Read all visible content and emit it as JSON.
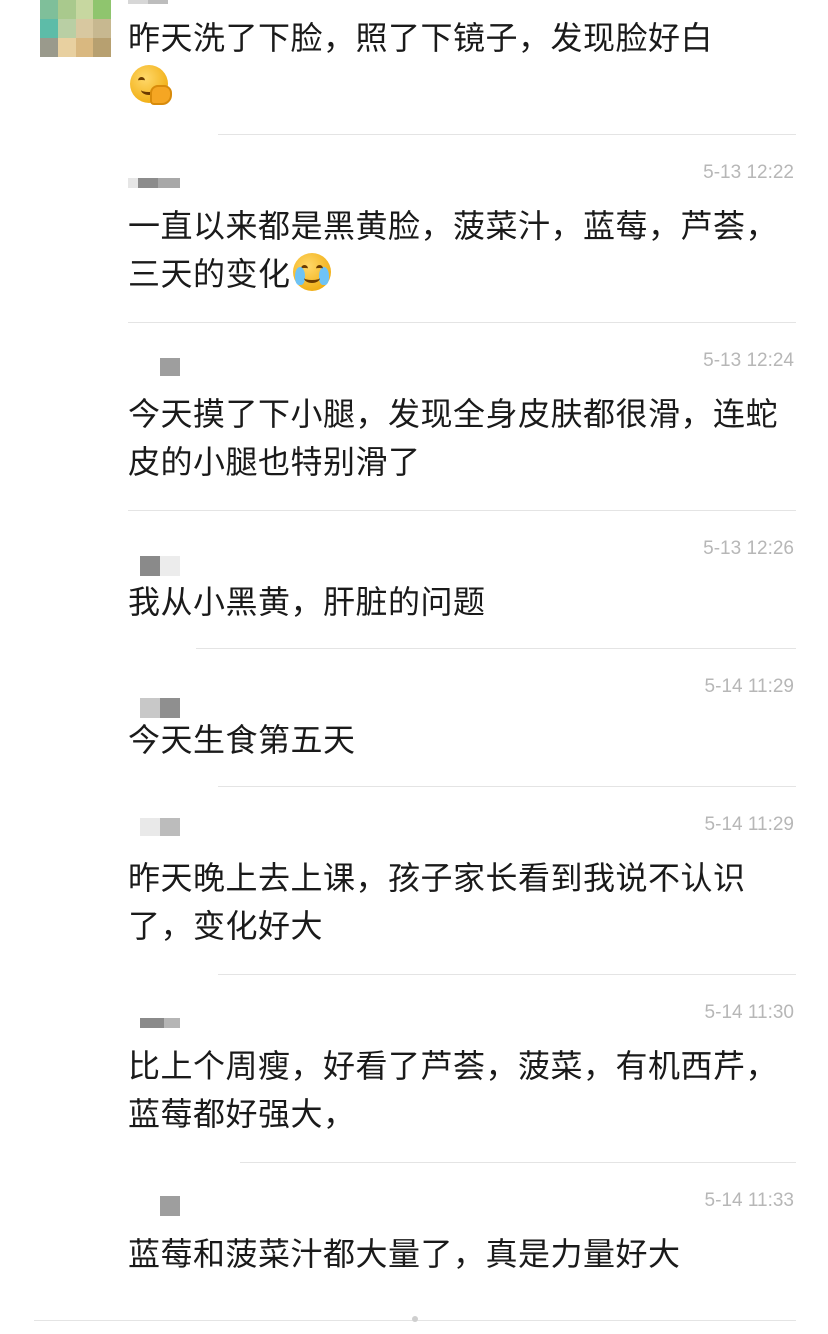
{
  "comments": [
    {
      "text": "昨天洗了下脸，照了下镜子，发现脸好白",
      "time": "",
      "emoji": "hand-over-mouth-face"
    },
    {
      "text": "一直以来都是黑黄脸，菠菜汁，蓝莓，芦荟，三天的变化",
      "time": "5-13 12:22",
      "emoji": "crying-face"
    },
    {
      "text": "今天摸了下小腿，发现全身皮肤都很滑，连蛇皮的小腿也特别滑了",
      "time": "5-13 12:24",
      "emoji": ""
    },
    {
      "text": "我从小黑黄，肝脏的问题",
      "time": "5-13 12:26",
      "emoji": ""
    },
    {
      "text": "今天生食第五天",
      "time": "5-14 11:29",
      "emoji": ""
    },
    {
      "text": "昨天晚上去上课，孩子家长看到我说不认识了，变化好大",
      "time": "5-14 11:29",
      "emoji": ""
    },
    {
      "text": "比上个周瘦，好看了芦荟，菠菜，有机西芹，蓝莓都好强大，",
      "time": "5-14 11:30",
      "emoji": ""
    },
    {
      "text": "蓝莓和菠菜汁都大量了，真是力量好大",
      "time": "5-14 11:33",
      "emoji": ""
    }
  ],
  "colors": {
    "text": "#1a1a1a",
    "time": "#b7b7b7",
    "divider": "#e4e4e4"
  }
}
